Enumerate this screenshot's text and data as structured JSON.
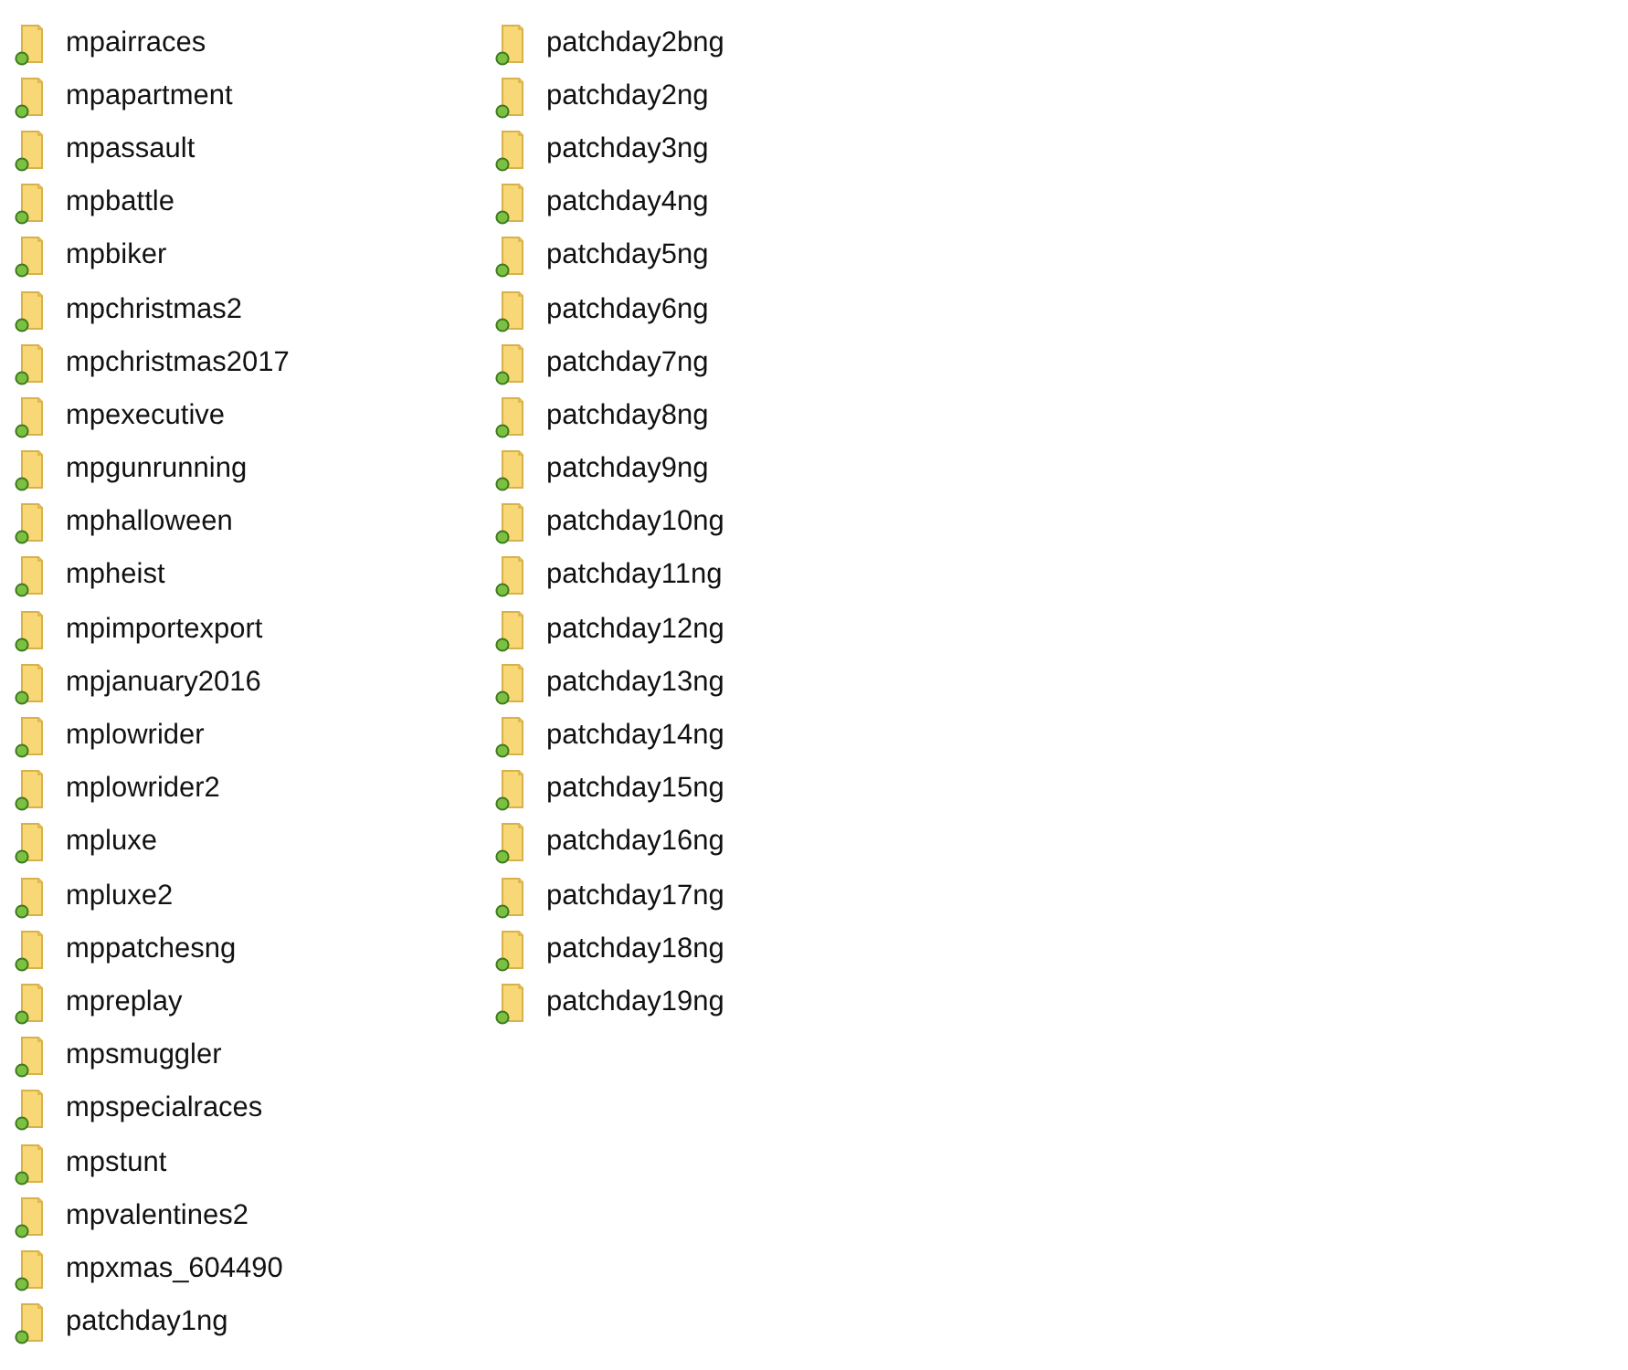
{
  "items": [
    {
      "name": "mpairraces"
    },
    {
      "name": "mpapartment"
    },
    {
      "name": "mpassault"
    },
    {
      "name": "mpbattle"
    },
    {
      "name": "mpbiker"
    },
    {
      "name": "mpchristmas2"
    },
    {
      "name": "mpchristmas2017"
    },
    {
      "name": "mpexecutive"
    },
    {
      "name": "mpgunrunning"
    },
    {
      "name": "mphalloween"
    },
    {
      "name": "mpheist"
    },
    {
      "name": "mpimportexport"
    },
    {
      "name": "mpjanuary2016"
    },
    {
      "name": "mplowrider"
    },
    {
      "name": "mplowrider2"
    },
    {
      "name": "mpluxe"
    },
    {
      "name": "mpluxe2"
    },
    {
      "name": "mppatchesng"
    },
    {
      "name": "mpreplay"
    },
    {
      "name": "mpsmuggler"
    },
    {
      "name": "mpspecialraces"
    },
    {
      "name": "mpstunt"
    },
    {
      "name": "mpvalentines2"
    },
    {
      "name": "mpxmas_604490"
    },
    {
      "name": "patchday1ng"
    },
    {
      "name": "patchday2bng"
    },
    {
      "name": "patchday2ng"
    },
    {
      "name": "patchday3ng"
    },
    {
      "name": "patchday4ng"
    },
    {
      "name": "patchday5ng"
    },
    {
      "name": "patchday6ng"
    },
    {
      "name": "patchday7ng"
    },
    {
      "name": "patchday8ng"
    },
    {
      "name": "patchday9ng"
    },
    {
      "name": "patchday10ng"
    },
    {
      "name": "patchday11ng"
    },
    {
      "name": "patchday12ng"
    },
    {
      "name": "patchday13ng"
    },
    {
      "name": "patchday14ng"
    },
    {
      "name": "patchday15ng"
    },
    {
      "name": "patchday16ng"
    },
    {
      "name": "patchday17ng"
    },
    {
      "name": "patchday18ng"
    },
    {
      "name": "patchday19ng"
    }
  ]
}
